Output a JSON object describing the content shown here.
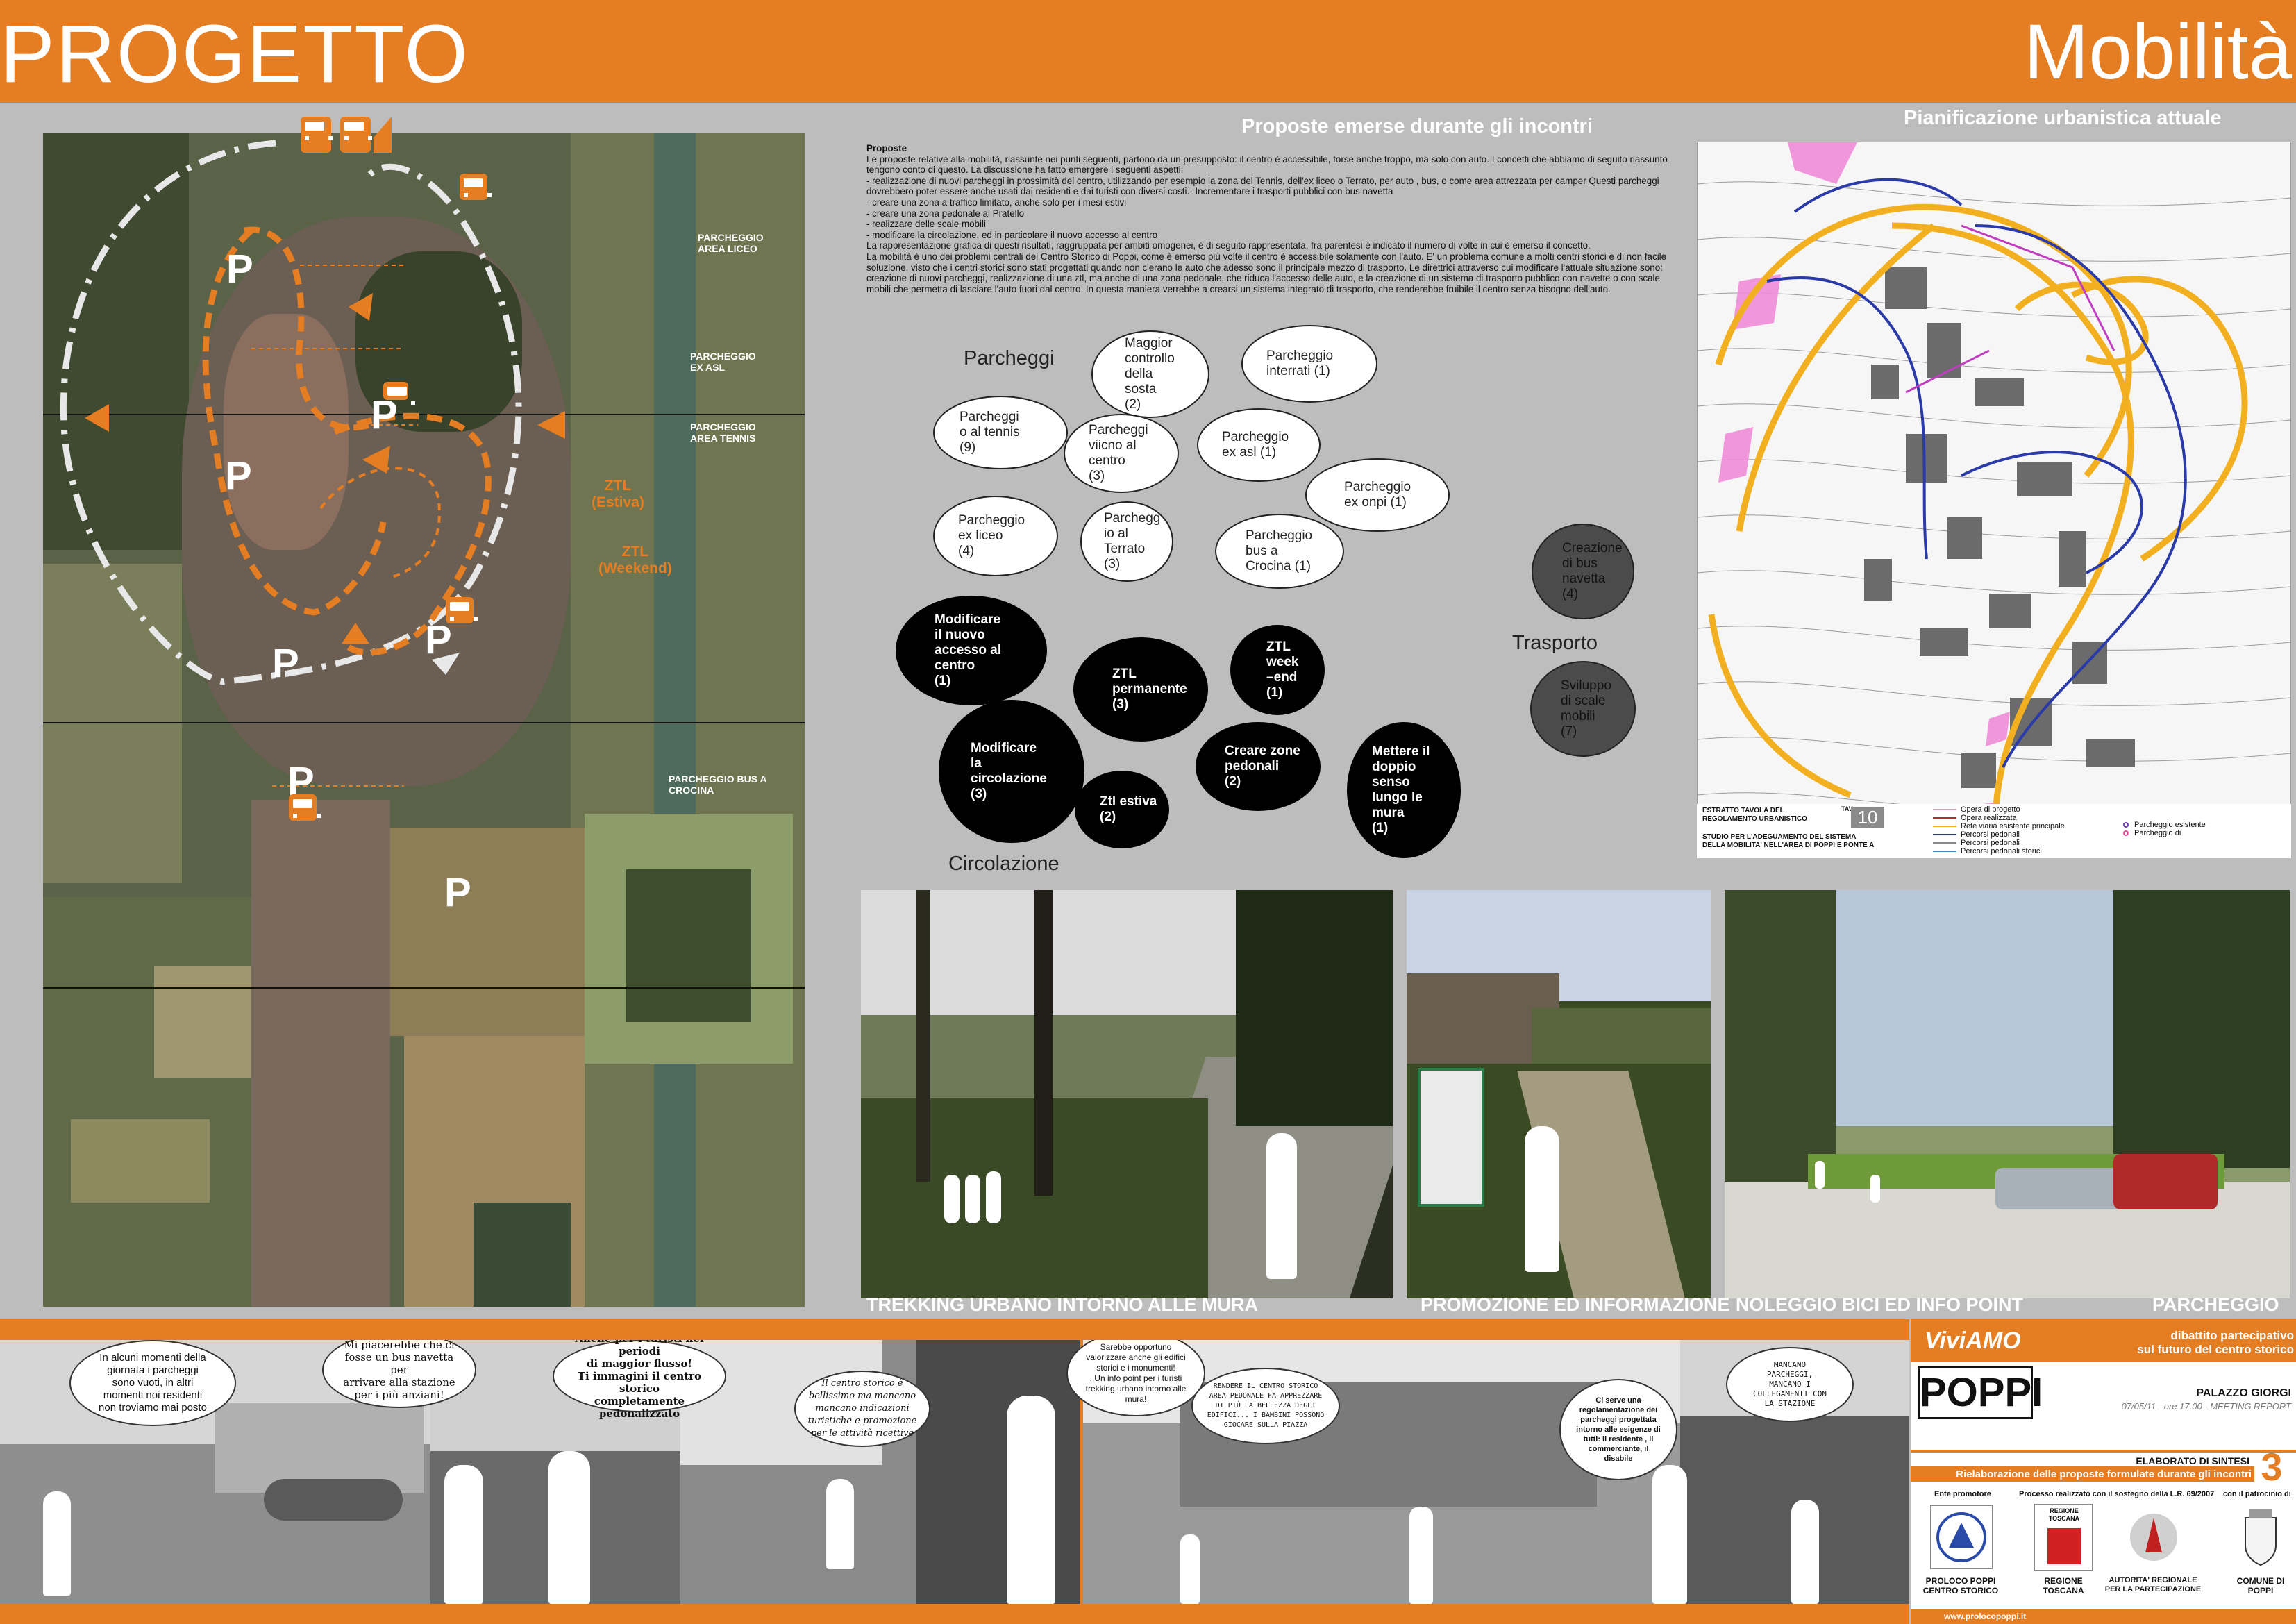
{
  "header": {
    "left_title": "PROGETTO",
    "right_title": "Mobilità"
  },
  "map": {
    "labels": [
      {
        "id": "liceo",
        "text": "PARCHEGGIO\nAREA LICEO"
      },
      {
        "id": "asl",
        "text": "PARCHEGGIO\nEX ASL"
      },
      {
        "id": "tennis",
        "text": "PARCHEGGIO\nAREA TENNIS"
      },
      {
        "id": "crocina",
        "text": "PARCHEGGIO BUS A\nCROCINA"
      }
    ],
    "ztl_estiva": "ZTL\n(Estiva)",
    "ztl_weekend": "ZTL\n(Weekend)",
    "p_marker": "P"
  },
  "proposte": {
    "title": "Proposte emerse durante gli incontri",
    "heading": "Proposte",
    "lines": [
      "Le proposte relative alla mobilità, riassunte nei punti seguenti, partono da un presupposto: il centro è accessibile, forse anche troppo, ma solo con auto. I concetti che abbiamo di seguito riassunto tengono conto di questo. La discussione ha fatto emergere i seguenti aspetti:",
      "- realizzazione di nuovi parcheggi in prossimità del centro, utilizzando per esempio la zona del Tennis, dell'ex liceo o Terrato, per auto , bus, o come area attrezzata per camper Questi parcheggi dovrebbero poter essere anche usati dai residenti e dai turisti con diversi costi.- Incrementare i trasporti pubblici con bus navetta",
      "- creare una zona a traffico limitato, anche solo per i mesi estivi",
      "- creare una zona pedonale al Pratello",
      "- realizzare delle scale mobili",
      "- modificare la circolazione, ed in particolare il nuovo accesso al centro",
      "La rappresentazione grafica di questi risultati, raggruppata per ambiti omogenei, è di seguito rappresentata, fra parentesi è indicato il numero di volte in cui è emerso il concetto.",
      "La mobilità è uno dei problemi centrali del Centro Storico di Poppi, come è emerso più volte il centro è accessibile solamente con l'auto. E' un problema comune a molti centri storici e di non facile soluzione, visto che i centri storici sono stati progettati quando non c'erano le auto che adesso sono il principale mezzo di trasporto. Le direttrici attraverso cui modificare l'attuale situazione sono: creazione di nuovi parcheggi, realizzazione di una ztl, ma anche di una zona pedonale, che riduca l'accesso delle auto, e la creazione di un sistema di trasporto pubblico con navette o con scale mobili che permetta di lasciare l'auto fuori dal centro. In questa maniera verrebbe a crearsi un sistema integrato di trasporto, che renderebbe fruibile il centro senza bisogno dell'auto."
    ]
  },
  "bubbles": {
    "categories": {
      "parcheggi": "Parcheggi",
      "circolazione": "Circolazione",
      "trasporto": "Trasporto"
    },
    "items": [
      {
        "id": "b1",
        "text": "Maggior\ncontrollo\ndella\nsosta\n(2)"
      },
      {
        "id": "b2",
        "text": "Parcheggio\ninterrati (1)"
      },
      {
        "id": "b3",
        "text": "Parcheggi\no al tennis\n(9)"
      },
      {
        "id": "b4",
        "text": "Parcheggi\nviicno al\ncentro\n(3)"
      },
      {
        "id": "b5",
        "text": "Parcheggio\nex asl (1)"
      },
      {
        "id": "b6",
        "text": "Parcheggio\nex onpi (1)"
      },
      {
        "id": "b7",
        "text": "Parcheggio\nex liceo\n(4)"
      },
      {
        "id": "b8",
        "text": "Parchegg\nio al\nTerrato\n(3)"
      },
      {
        "id": "b9",
        "text": "Parcheggio\nbus a\nCrocina (1)"
      },
      {
        "id": "b10",
        "text": "Creazione\ndi bus\nnavetta\n(4)"
      },
      {
        "id": "b11",
        "text": "Sviluppo\ndi scale\nmobili\n(7)"
      },
      {
        "id": "b12",
        "text": "Modificare\nil nuovo\naccesso al\ncentro\n(1)"
      },
      {
        "id": "b13",
        "text": "ZTL\npermanente\n(3)"
      },
      {
        "id": "b14",
        "text": "ZTL week\n–end\n(1)"
      },
      {
        "id": "b15",
        "text": "Modificare\nla\ncircolazione\n(3)"
      },
      {
        "id": "b16",
        "text": "Ztl estiva\n(2)"
      },
      {
        "id": "b17",
        "text": "Creare zone\npedonali\n(2)"
      },
      {
        "id": "b18",
        "text": "Mettere il\ndoppio\nsenso\nlungo le\nmura\n(1)"
      }
    ]
  },
  "plan": {
    "title": "Pianificazione urbanistica attuale",
    "legend_box_1": "ESTRATTO TAVOLA DEL\nREGOLAMENTO URBANISTICO",
    "legend_box_2": "STUDIO PER L'ADEGUAMENTO DEL SISTEMA\nDELLA MOBILITA' NELL'AREA DI POPPI E PONTE A",
    "tav": "TAV",
    "tav_number": "10",
    "legend_items": [
      {
        "text": "Opera di progetto",
        "color": "#e0a0c0"
      },
      {
        "text": "Opera realizzata",
        "color": "#b03030"
      },
      {
        "text": "Rete viaria esistente principale",
        "color": "#f2b021"
      },
      {
        "text": "Percorsi pedonali",
        "color": "#2a3aa8"
      },
      {
        "text": "Percorsi pedonali",
        "color": "#8a8a8a"
      },
      {
        "text": "Percorsi pedonali storici",
        "color": "#3a8ad0"
      }
    ],
    "legend_right": [
      "Parcheggio esistente",
      "Parcheggio di"
    ]
  },
  "photos": {
    "trekking": "TREKKING URBANO INTORNO ALLE MURA",
    "promozione": "PROMOZIONE ED INFORMAZIONE",
    "noleggio": "NOLEGGIO BICI ED INFO POINT",
    "parcheggio": "PARCHEGGIO"
  },
  "strip": {
    "clouds": [
      {
        "id": "c1",
        "text": "In alcuni momenti della\ngiornata i parcheggi\nsono vuoti, in altri\nmomenti noi residenti\nnon troviamo mai posto"
      },
      {
        "id": "c2",
        "text": "Mi piacerebbe che ci\nfosse un bus navetta per\narrivare alla stazione\nper i più anziani!"
      },
      {
        "id": "c3",
        "text": "Anche per i turisti nei periodi\ndi maggior flusso!\nTi immagini il centro storico\ncompletamente pedonalizzato"
      },
      {
        "id": "c4",
        "text": "Il centro storico è\nbellissimo ma mancano\nmancano indicazioni\nturistiche e promozione\nper le attività ricettive"
      },
      {
        "id": "c5",
        "text": "Sarebbe opportuno\nvalorizzare anche gli edifici\nstorici e i monumenti!\n..Un info point per i turisti\ntrekking urbano intorno alle\nmura!"
      },
      {
        "id": "c6",
        "text": "RENDERE IL CENTRO STORICO\nAREA PEDONALE FA APPREZZARE\nDI PIÙ LA BELLEZZA DEGLI\nEDIFICI... I BAMBINI POSSONO\nGIOCARE SULLA PIAZZA"
      },
      {
        "id": "c7",
        "text": "Ci serve una\nregolamentazione dei\nparcheggi progettata\nintorno alle esigenze di\ntutti: il residente , il\ncommerciante, il\ndisabile"
      },
      {
        "id": "c8",
        "text": "MANCANO\nPARCHEGGI,\nMANCANO I\nCOLLEGAMENTI CON\nLA STAZIONE"
      }
    ]
  },
  "info": {
    "viviamo": "ViviAMO",
    "dibattito": "dibattito partecipativo\nsul futuro del centro storico",
    "poppi": "POPPI",
    "palazzo": "PALAZZO GIORGI",
    "date": "07/05/11 - ore 17.00 - MEETING REPORT",
    "elaborato": "ELABORATO DI SINTESI",
    "rielab": "Rielaborazione delle proposte formulate durante gli incontri",
    "number": "3",
    "ente": "Ente promotore",
    "processo": "Processo realizzato con il sostegno della L.R. 69/2007",
    "patrocinio": "con il patrocinio di",
    "proloco": "PROLOCO POPPI\nCENTRO STORICO",
    "regione": "REGIONE\nTOSCANA",
    "regione_logo": "REGIONE\nTOSCANA",
    "autorita": "AUTORITA' REGIONALE\nPER LA PARTECIPAZIONE",
    "comune": "COMUNE DI\nPOPPI",
    "website": "www.prolocopoppi.it"
  },
  "colors": {
    "orange": "#e57d22",
    "panel_gray": "#bdbdbd",
    "black": "#000000",
    "white": "#ffffff"
  }
}
